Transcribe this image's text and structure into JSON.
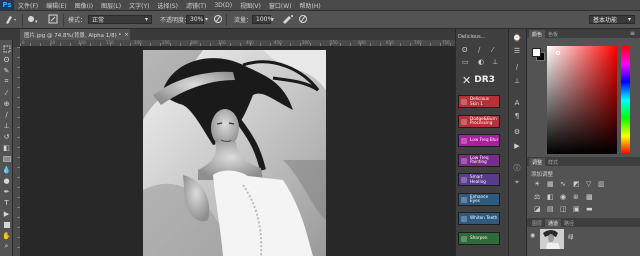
{
  "app": {
    "logo": "Ps"
  },
  "menu": [
    "文件(F)",
    "编辑(E)",
    "图像(I)",
    "图层(L)",
    "文字(Y)",
    "选择(S)",
    "滤镜(T)",
    "3D(D)",
    "视图(V)",
    "窗口(W)",
    "帮助(H)"
  ],
  "options": {
    "mode_label": "模式：",
    "mode_value": "正常",
    "opacity_label": "不透明度：",
    "opacity_value": "30%",
    "flow_label": "流量：",
    "flow_value": "100%",
    "workspace": "基本功能"
  },
  "document": {
    "tab_label": "图片.jpg @ 74.8%(背景, Alpha 1/8) *",
    "close": "×",
    "ruler_numbers": [
      "0",
      "50",
      "100",
      "150",
      "200",
      "250",
      "300",
      "350",
      "400",
      "450",
      "500",
      "550",
      "600",
      "650",
      "700",
      "750"
    ]
  },
  "plugin": {
    "tab_label": "Delicious...",
    "logo": "DR3",
    "buttons": [
      {
        "label": "Delicious Skin 1",
        "color": "#b5323a"
      },
      {
        "label": "Dodge&Burn Processing",
        "color": "#b5323a"
      },
      {
        "label": "Low Freq Blur",
        "color": "#a8209a"
      },
      {
        "label": "Low Freq Painting",
        "color": "#7a2c8a"
      },
      {
        "label": "Smart Healing",
        "color": "#5a3a8a"
      },
      {
        "label": "Enhance Eyes",
        "color": "#2f5a80"
      },
      {
        "label": "Whiten Teeth",
        "color": "#2f5a80"
      },
      {
        "label": "Sharpen",
        "color": "#2f6a3a"
      }
    ]
  },
  "panels": {
    "color_tab": "颜色",
    "swatches_tab": "色板",
    "adjust_tab": "调整",
    "styles_tab": "样式",
    "adjust_title": "添加调整",
    "layers_tab": "图层",
    "channels_tab": "通道",
    "paths_tab": "路径",
    "layer_name": "绿"
  },
  "colors": {
    "accent_blue": "#31a8ff",
    "foreground": "#ffffff",
    "background": "#000000"
  }
}
